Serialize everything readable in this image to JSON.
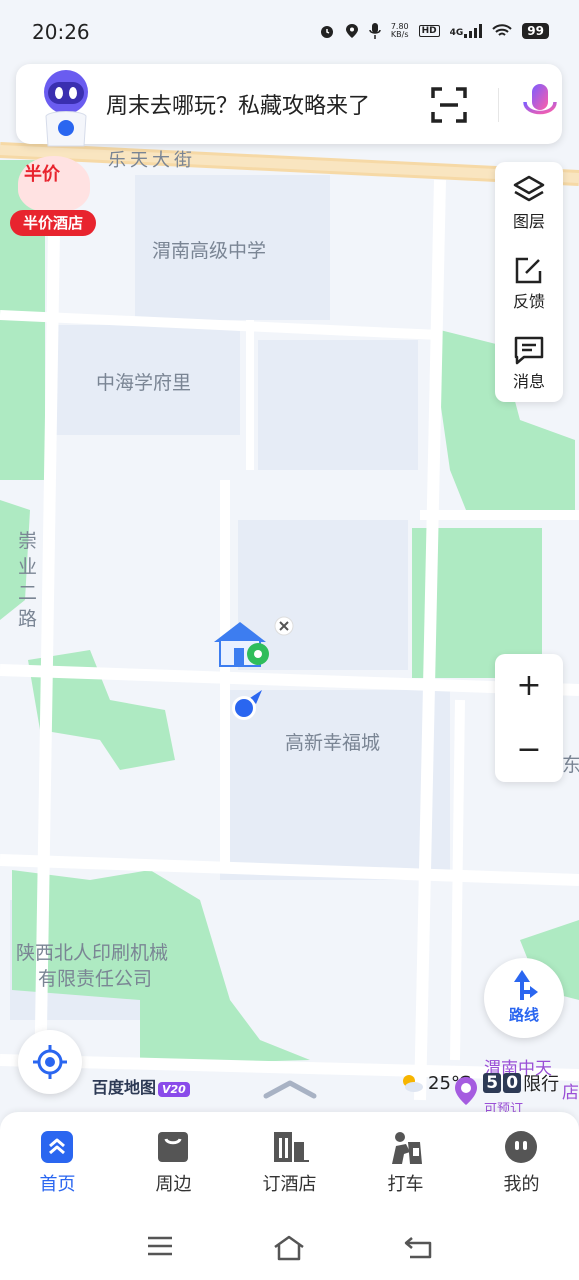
{
  "status_bar": {
    "time": "20:26",
    "net_speed_value": "7.80",
    "net_speed_unit": "KB/s",
    "hd": "HD",
    "network": "4G",
    "battery": "99"
  },
  "search": {
    "placeholder": "周末去哪玩？私藏攻略来了"
  },
  "promo": {
    "badge": "半价",
    "label": "半价酒店"
  },
  "tools": {
    "layers": "图层",
    "feedback": "反馈",
    "messages": "消息"
  },
  "map_labels": {
    "street_letian": "乐天大街",
    "school": "渭南高级中学",
    "residential_1": "中海学府里",
    "road_chongye": "崇业二路",
    "residential_2": "高新幸福城",
    "company_1": "陕西北人印刷机械",
    "company_2": "有限责任公司",
    "edge_char": "东",
    "poi_weinan": "渭南中天",
    "poi_booking": "可预订",
    "poi_shop": "店"
  },
  "zoom": {
    "in": "+",
    "out": "−"
  },
  "route": {
    "label": "路线"
  },
  "footer": {
    "logo": "百度地图",
    "version": "V20",
    "temperature": "25℃",
    "restriction_digit1": "5",
    "restriction_digit2": "0",
    "restriction_label": "限行"
  },
  "bottom_nav": [
    {
      "label": "首页",
      "active": true
    },
    {
      "label": "周边",
      "active": false
    },
    {
      "label": "订酒店",
      "active": false
    },
    {
      "label": "打车",
      "active": false
    },
    {
      "label": "我的",
      "active": false
    }
  ],
  "colors": {
    "accent": "#2a66f0",
    "promo_red": "#e8242e",
    "green_area": "#aeeac2",
    "road": "#ffffff",
    "main_road": "#f6d9a6"
  }
}
